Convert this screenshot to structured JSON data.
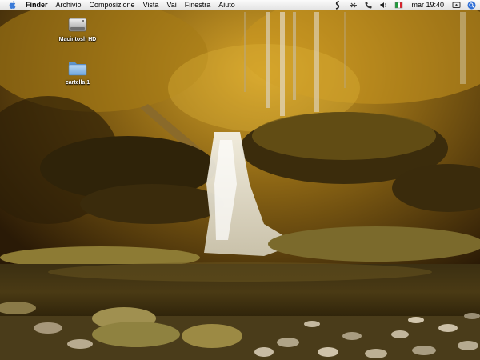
{
  "menubar": {
    "app_name": "Finder",
    "items": [
      "Archivio",
      "Composizione",
      "Vista",
      "Vai",
      "Finestra",
      "Aiuto"
    ],
    "status_icons": [
      "script-icon",
      "network-icon",
      "phone-icon",
      "volume-icon",
      "flag-icon"
    ],
    "clock": "mar 19:40",
    "spotlight": "spotlight-icon"
  },
  "desktop": {
    "icons": [
      {
        "label": "Macintosh HD",
        "icon": "hard-drive-icon"
      },
      {
        "label": "cartella 1",
        "icon": "folder-icon"
      }
    ],
    "wallpaper": "forest waterfall"
  },
  "colors": {
    "menubar_bg": "#ececec",
    "folder_blue": "#7fb2e6",
    "foliage": "#c79a1e"
  }
}
